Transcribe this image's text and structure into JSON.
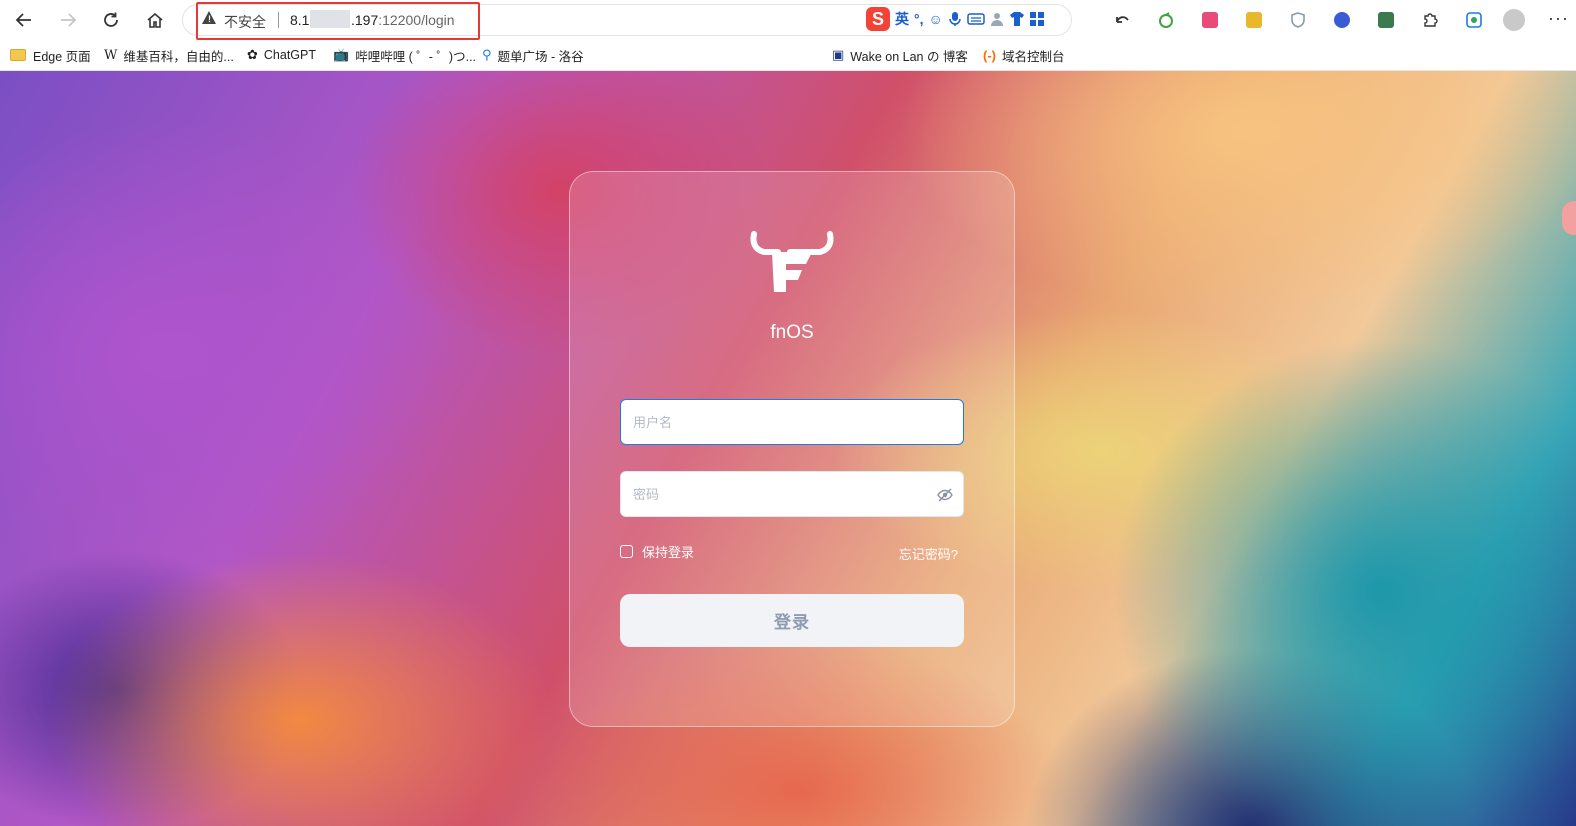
{
  "browser": {
    "security_label": "不安全",
    "url_host_prefix": "8.1",
    "url_host_suffix": ".197",
    "url_port_path": ":12200/login",
    "ime": {
      "mode_label": "英",
      "punct_label": "°,",
      "emoji_label": "☺"
    }
  },
  "bookmarks": [
    "Edge 页面",
    "维基百科，自由的...",
    "ChatGPT",
    "哔哩哔哩 ( ゜- ゜)つ...",
    "题单广场 - 洛谷",
    "Wake on Lan の 博客",
    "域名控制台"
  ],
  "login": {
    "brand": "fnOS",
    "username_placeholder": "用户名",
    "password_placeholder": "密码",
    "remember_label": "保持登录",
    "forgot_label": "忘记密码?",
    "login_button": "登录"
  },
  "colors": {
    "accent_focus": "#1e7be6",
    "button_bg": "#f1f3f7",
    "button_text": "#8f9bb1",
    "highlight_border": "#e53935"
  }
}
